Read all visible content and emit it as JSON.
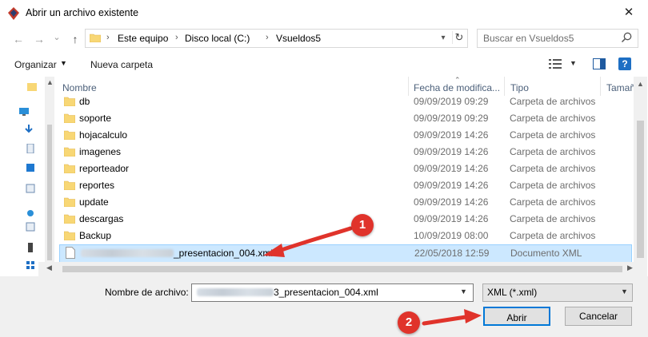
{
  "window": {
    "title": "Abrir un archivo existente",
    "close_glyph": "✕"
  },
  "nav": {
    "back_glyph": "←",
    "forward_glyph": "→",
    "recent_glyph": "⌄",
    "up_glyph": "↑",
    "breadcrumbs": [
      "Este equipo",
      "Disco local (C:)",
      "Vsueldos5"
    ],
    "separator": "›",
    "search_placeholder": "Buscar en Vsueldos5"
  },
  "toolbar": {
    "organize_label": "Organizar",
    "new_folder_label": "Nueva carpeta",
    "help_glyph": "?"
  },
  "columns": {
    "name": "Nombre",
    "date": "Fecha de modifica...",
    "type": "Tipo",
    "size": "Tamañ"
  },
  "files": [
    {
      "name": "db",
      "date": "09/09/2019 09:29",
      "type": "Carpeta de archivos",
      "icon": "folder-icon"
    },
    {
      "name": "soporte",
      "date": "09/09/2019 09:29",
      "type": "Carpeta de archivos",
      "icon": "folder-icon"
    },
    {
      "name": "hojacalculo",
      "date": "09/09/2019 14:26",
      "type": "Carpeta de archivos",
      "icon": "folder-icon"
    },
    {
      "name": "imagenes",
      "date": "09/09/2019 14:26",
      "type": "Carpeta de archivos",
      "icon": "folder-icon"
    },
    {
      "name": "reporteador",
      "date": "09/09/2019 14:26",
      "type": "Carpeta de archivos",
      "icon": "folder-icon"
    },
    {
      "name": "reportes",
      "date": "09/09/2019 14:26",
      "type": "Carpeta de archivos",
      "icon": "folder-icon"
    },
    {
      "name": "update",
      "date": "09/09/2019 14:26",
      "type": "Carpeta de archivos",
      "icon": "folder-icon"
    },
    {
      "name": "descargas",
      "date": "09/09/2019 14:26",
      "type": "Carpeta de archivos",
      "icon": "folder-icon"
    },
    {
      "name": "Backup",
      "date": "10/09/2019 08:00",
      "type": "Carpeta de archivos",
      "icon": "folder-icon"
    },
    {
      "name": "_presentacion_004.xml",
      "date": "22/05/2018 12:59",
      "type": "Documento XML",
      "icon": "xml-file-icon",
      "selected": true
    }
  ],
  "footer": {
    "filename_label": "Nombre de archivo:",
    "filename_value": "3_presentacion_004.xml",
    "filter_value": "XML (*.xml)",
    "open_label": "Abrir",
    "cancel_label": "Cancelar"
  },
  "annotations": {
    "step1": "1",
    "step2": "2",
    "color": "#e0332b"
  }
}
